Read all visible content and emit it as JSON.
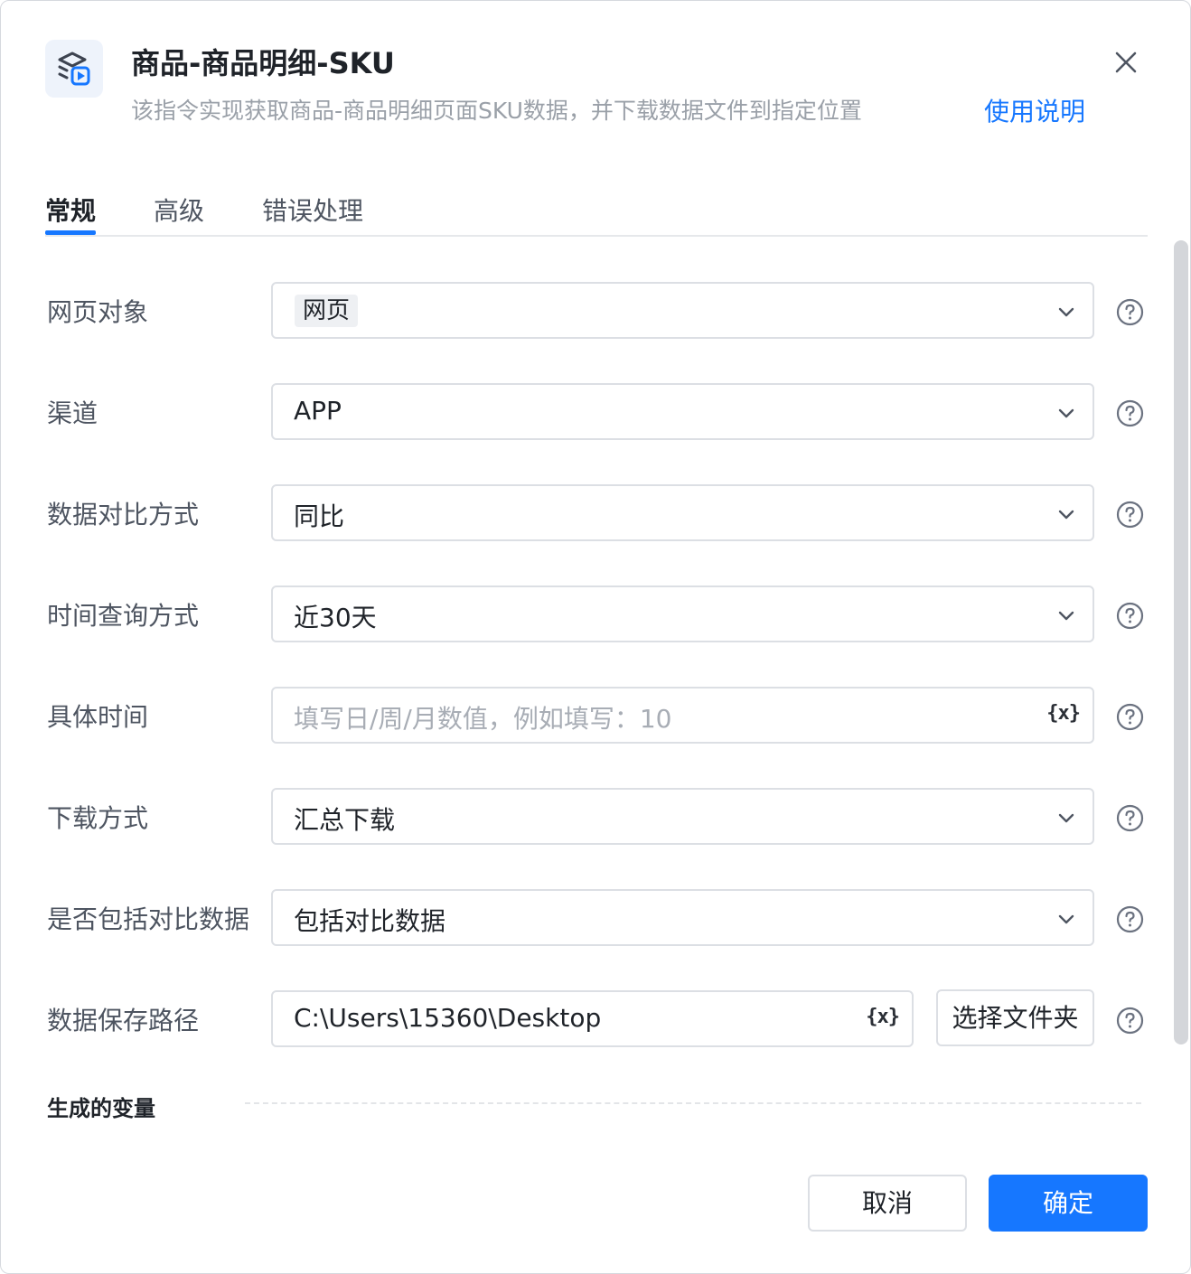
{
  "header": {
    "title": "商品-商品明细-SKU",
    "subtitle": "该指令实现获取商品-商品明细页面SKU数据，并下载数据文件到指定位置",
    "help_link": "使用说明",
    "app_icon": "layers-play-icon",
    "close_icon": "close-icon"
  },
  "tabs": [
    {
      "label": "常规",
      "active": true
    },
    {
      "label": "高级",
      "active": false
    },
    {
      "label": "错误处理",
      "active": false
    }
  ],
  "form": {
    "web_object": {
      "label": "网页对象",
      "tag": "网页"
    },
    "channel": {
      "label": "渠道",
      "value": "APP"
    },
    "compare_mode": {
      "label": "数据对比方式",
      "value": "同比"
    },
    "time_query": {
      "label": "时间查询方式",
      "value": "近30天"
    },
    "specific_time": {
      "label": "具体时间",
      "placeholder": "填写日/周/月数值，例如填写：10",
      "var_icon": "{x}"
    },
    "download_mode": {
      "label": "下载方式",
      "value": "汇总下载"
    },
    "include_compare": {
      "label": "是否包括对比数据",
      "value": "包括对比数据"
    },
    "save_path": {
      "label": "数据保存路径",
      "value": "C:\\Users\\15360\\Desktop",
      "var_icon": "{x}",
      "folder_button": "选择文件夹"
    }
  },
  "generated_vars": {
    "title": "生成的变量"
  },
  "footer": {
    "cancel": "取消",
    "ok": "确定"
  },
  "colors": {
    "accent": "#1677ff",
    "border": "#dcdfe4",
    "muted_text": "#9aa0a8"
  }
}
